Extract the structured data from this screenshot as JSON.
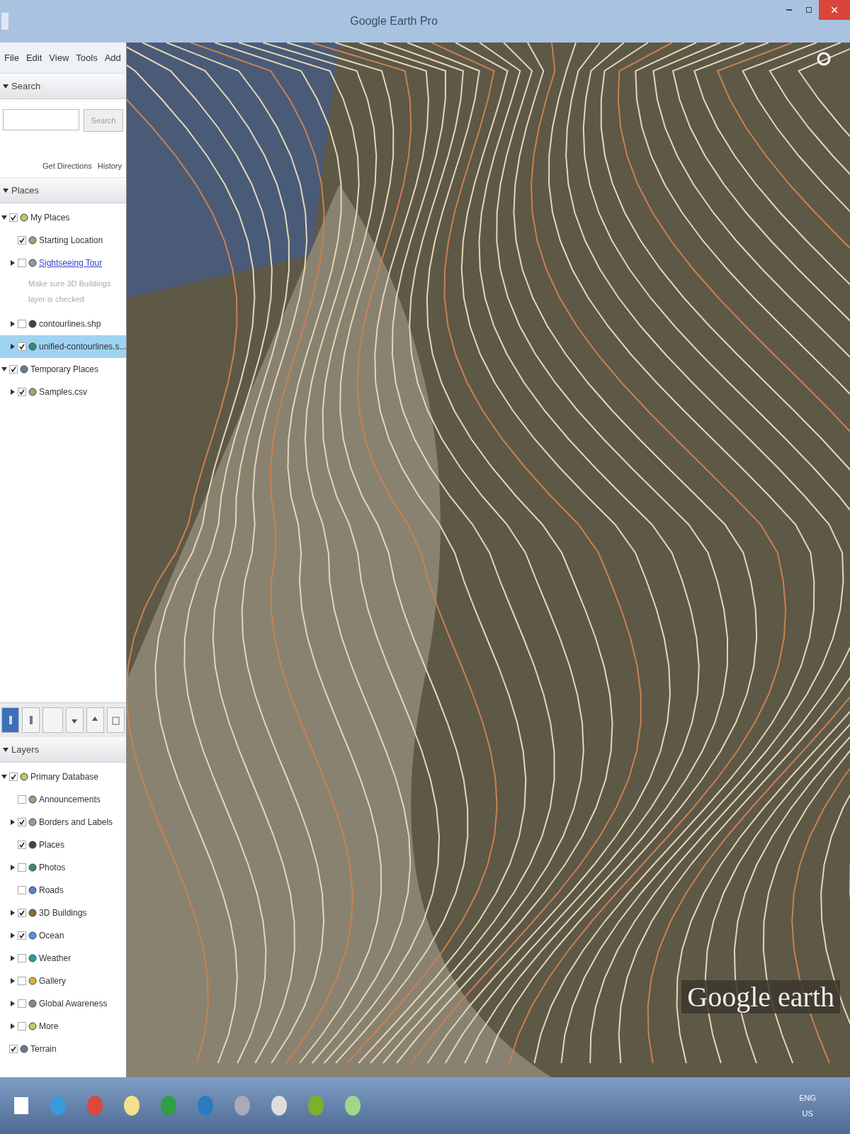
{
  "window": {
    "title": "Google Earth Pro"
  },
  "menu": [
    "File",
    "Edit",
    "View",
    "Tools",
    "Add"
  ],
  "search": {
    "header": "Search",
    "button": "Search",
    "links": [
      "Get Directions",
      "History"
    ]
  },
  "places": {
    "header": "Places",
    "items": [
      {
        "label": "My Places",
        "checked": true,
        "expanded": true,
        "selected": false,
        "children": [
          {
            "label": "Starting Location",
            "checked": true,
            "selected": false
          },
          {
            "label": "Sightseeing Tour",
            "kind": "link",
            "checked": false,
            "expanded": false,
            "selected": false,
            "note": "Make sure 3D Buildings layer is checked"
          },
          {
            "label": "contourlines.shp",
            "checked": false,
            "expanded": false,
            "selected": false
          },
          {
            "label": "unified-contourlines.s...",
            "checked": true,
            "expanded": false,
            "selected": true
          }
        ]
      },
      {
        "label": "Temporary Places",
        "checked": true,
        "expanded": true,
        "selected": false,
        "children": [
          {
            "label": "Samples.csv",
            "checked": true,
            "expanded": false,
            "selected": false
          }
        ]
      }
    ]
  },
  "layers": {
    "header": "Layers",
    "items": [
      {
        "label": "Primary Database",
        "checked": true,
        "expanded": true,
        "children": [
          {
            "label": "Announcements",
            "checked": false
          },
          {
            "label": "Borders and Labels",
            "checked": true,
            "expanded": false
          },
          {
            "label": "Places",
            "checked": true
          },
          {
            "label": "Photos",
            "checked": false,
            "expanded": false
          },
          {
            "label": "Roads",
            "checked": false
          },
          {
            "label": "3D Buildings",
            "checked": true,
            "expanded": false
          },
          {
            "label": "Ocean",
            "checked": true,
            "expanded": false
          },
          {
            "label": "Weather",
            "checked": false,
            "expanded": false
          },
          {
            "label": "Gallery",
            "checked": false,
            "expanded": false
          },
          {
            "label": "Global Awareness",
            "checked": false,
            "expanded": false
          },
          {
            "label": "More",
            "checked": false,
            "expanded": false
          }
        ]
      },
      {
        "label": "Terrain",
        "checked": true
      }
    ]
  },
  "map": {
    "logo": "Google earth"
  },
  "taskbar": {
    "tray": [
      "ENG",
      "US"
    ]
  }
}
